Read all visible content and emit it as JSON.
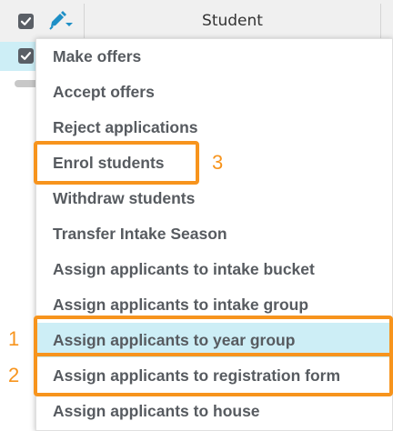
{
  "table": {
    "column_header": "Student"
  },
  "icons": {
    "checkbox": "checkbox-checked-icon",
    "edit": "pencil-edit-icon"
  },
  "menu": {
    "items": [
      {
        "label": "Make offers"
      },
      {
        "label": "Accept offers"
      },
      {
        "label": "Reject applications"
      },
      {
        "label": "Enrol students"
      },
      {
        "label": "Withdraw students"
      },
      {
        "label": "Transfer Intake Season"
      },
      {
        "label": "Assign applicants to intake bucket"
      },
      {
        "label": "Assign applicants to intake group"
      },
      {
        "label": "Assign applicants to year group",
        "highlighted": true
      },
      {
        "label": "Assign applicants to registration form"
      },
      {
        "label": "Assign applicants to house"
      }
    ]
  },
  "annotations": {
    "n1": "1",
    "n2": "2",
    "n3": "3"
  },
  "colors": {
    "annotation": "#f7941d",
    "highlight": "#cdeef6",
    "edit_icon": "#1e8fc6",
    "checkbox": "#5a5f66"
  }
}
